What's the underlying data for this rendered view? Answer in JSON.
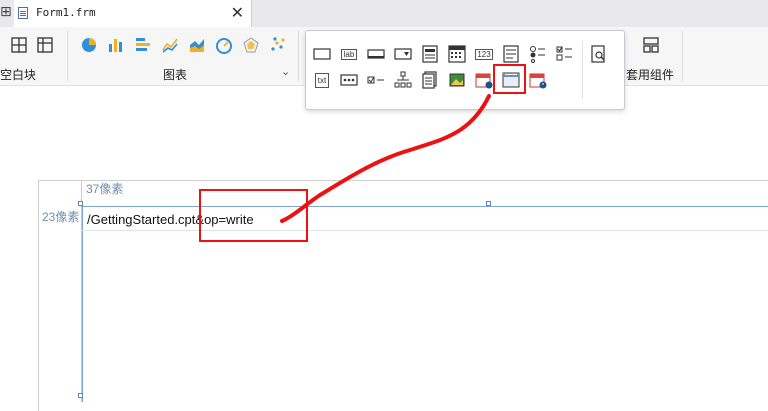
{
  "tab": {
    "title": "Form1.frm",
    "close": "✕",
    "left_icon": "⊞"
  },
  "ribbon": {
    "groups": [
      {
        "label": "空白块"
      },
      {
        "label": "图表"
      },
      {
        "label": "套用组件"
      }
    ],
    "chevron": "⌄"
  },
  "widgets_popup": {
    "row1": [
      "text-box-icon",
      "label-icon",
      "button-icon",
      "dropdown-icon",
      "form-icon",
      "grid-calendar-icon",
      "number-icon",
      "list-icon",
      "radio-group-icon",
      "checkbox-group-icon"
    ],
    "row2": [
      "text-area-icon",
      "password-icon",
      "checkbox-icon",
      "tree-icon",
      "file-icon",
      "image-icon",
      "date-icon",
      "web-frame-icon",
      "datetime-icon"
    ],
    "lab_text": "lab",
    "num_text": "123",
    "txt_text": "txt",
    "search_icon": "search-icon",
    "highlight_color": "#ee1111"
  },
  "canvas": {
    "top_ruler": "37像素",
    "left_ruler": "23像素",
    "url_value": "/GettingStarted.cpt&op=write"
  }
}
